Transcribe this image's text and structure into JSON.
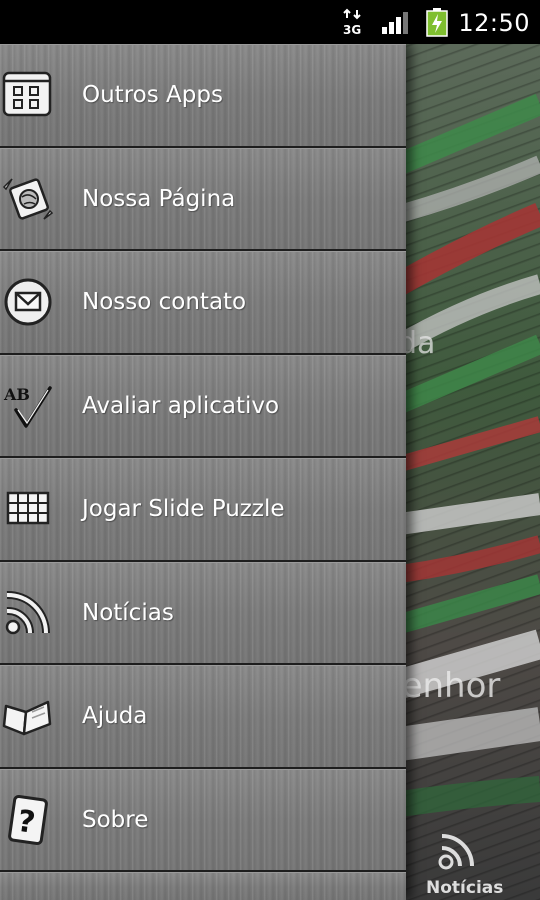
{
  "status_bar": {
    "network_label": "3G",
    "clock": "12:50"
  },
  "background_app": {
    "overlay_text_1": "da",
    "overlay_text_2": "Senhor",
    "bottom_tab_label": "Notícias"
  },
  "drawer": {
    "items": [
      {
        "label": "Outros Apps",
        "icon": "apps-grid-icon"
      },
      {
        "label": "Nossa Página",
        "icon": "globe-page-icon"
      },
      {
        "label": "Nosso contato",
        "icon": "envelope-icon"
      },
      {
        "label": "Avaliar aplicativo",
        "icon": "check-rating-icon"
      },
      {
        "label": "Jogar Slide Puzzle",
        "icon": "puzzle-grid-icon"
      },
      {
        "label": "Notícias",
        "icon": "rss-icon"
      },
      {
        "label": "Ajuda",
        "icon": "book-icon"
      },
      {
        "label": "Sobre",
        "icon": "question-card-icon"
      }
    ]
  }
}
